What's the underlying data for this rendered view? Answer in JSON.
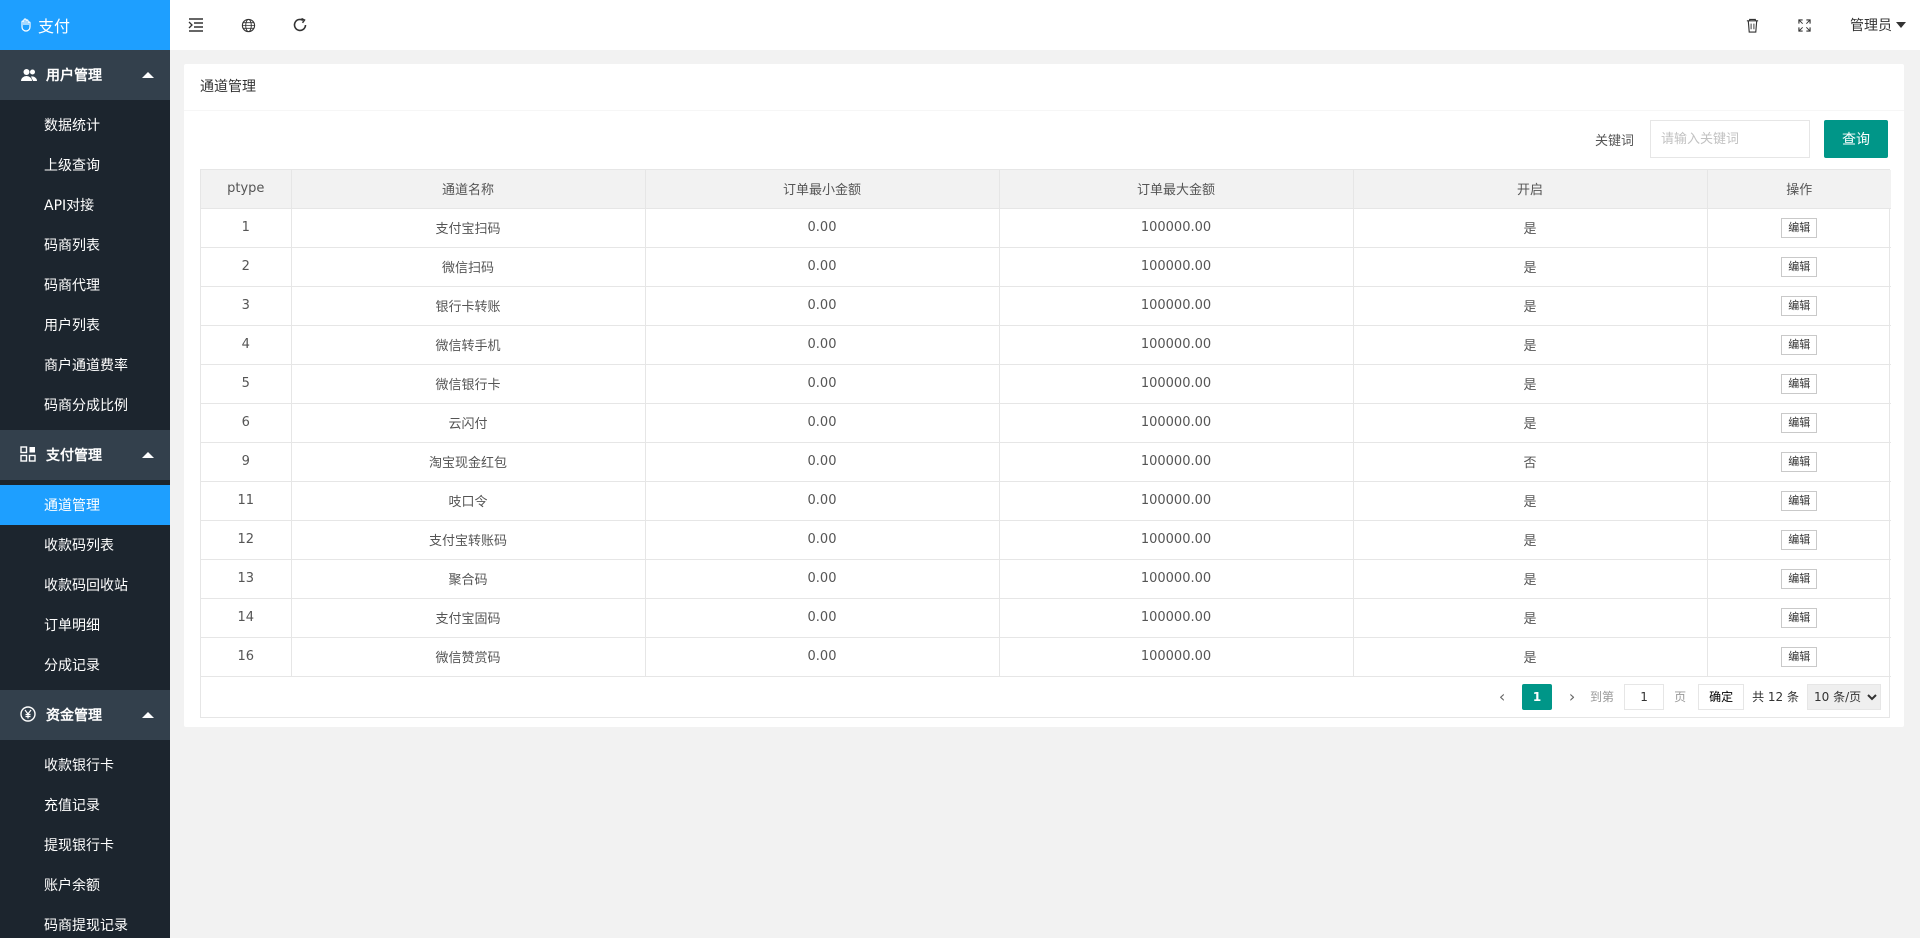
{
  "app": {
    "logo_text": "支付"
  },
  "sidebar": {
    "groups": [
      {
        "title": "用户管理",
        "icon": "users-icon",
        "items": [
          "数据统计",
          "上级查询",
          "API对接",
          "码商列表",
          "码商代理",
          "用户列表",
          "商户通道费率",
          "码商分成比例"
        ]
      },
      {
        "title": "支付管理",
        "icon": "apps-icon",
        "items": [
          "通道管理",
          "收款码列表",
          "收款码回收站",
          "订单明细",
          "分成记录"
        ]
      },
      {
        "title": "资金管理",
        "icon": "yen-icon",
        "items": [
          "收款银行卡",
          "充值记录",
          "提现银行卡",
          "账户余额",
          "码商提现记录"
        ]
      }
    ],
    "active_item": "通道管理"
  },
  "topbar": {
    "user_label": "管理员"
  },
  "main": {
    "card_title": "通道管理",
    "search": {
      "label": "关键词",
      "placeholder": "请输入关键词",
      "button_label": "查询"
    },
    "table": {
      "headers": [
        "ptype",
        "通道名称",
        "订单最小金额",
        "订单最大金额",
        "开启",
        "操作"
      ],
      "edit_label": "编辑",
      "rows": [
        [
          "1",
          "支付宝扫码",
          "0.00",
          "100000.00",
          "是"
        ],
        [
          "2",
          "微信扫码",
          "0.00",
          "100000.00",
          "是"
        ],
        [
          "3",
          "银行卡转账",
          "0.00",
          "100000.00",
          "是"
        ],
        [
          "4",
          "微信转手机",
          "0.00",
          "100000.00",
          "是"
        ],
        [
          "5",
          "微信银行卡",
          "0.00",
          "100000.00",
          "是"
        ],
        [
          "6",
          "云闪付",
          "0.00",
          "100000.00",
          "是"
        ],
        [
          "9",
          "淘宝现金红包",
          "0.00",
          "100000.00",
          "否"
        ],
        [
          "11",
          "吱口令",
          "0.00",
          "100000.00",
          "是"
        ],
        [
          "12",
          "支付宝转账码",
          "0.00",
          "100000.00",
          "是"
        ],
        [
          "13",
          "聚合码",
          "0.00",
          "100000.00",
          "是"
        ],
        [
          "14",
          "支付宝固码",
          "0.00",
          "100000.00",
          "是"
        ],
        [
          "16",
          "微信赞赏码",
          "0.00",
          "100000.00",
          "是"
        ]
      ]
    },
    "pager": {
      "current_page": "1",
      "goto_label": "到第",
      "goto_value": "1",
      "page_unit": "页",
      "confirm_label": "确定",
      "total_text": "共 12 条",
      "page_size": "10 条/页"
    }
  }
}
